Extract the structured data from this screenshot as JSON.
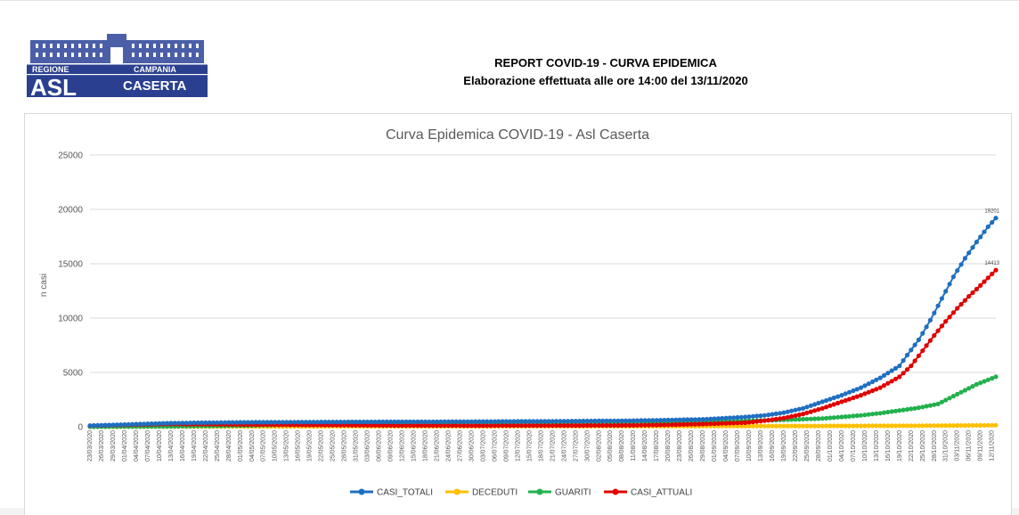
{
  "header": {
    "logo": {
      "icon": "palace-icon",
      "region_text": "REGIONE",
      "campania_text": "CAMPANIA",
      "asl_text": "ASL",
      "caserta_text": "CASERTA",
      "color": "#2a3f8f"
    },
    "title_line1": "REPORT COVID-19 - CURVA EPIDEMICA",
    "title_line2": "Elaborazione effettuata alle ore 14:00 del 13/11/2020"
  },
  "chart_data": {
    "type": "line",
    "title": "Curva Epidemica COVID-19 - Asl Caserta",
    "xlabel": "",
    "ylabel": "n casi",
    "ylim": [
      0,
      25000
    ],
    "yticks": [
      "0",
      "5000",
      "10000",
      "15000",
      "20000",
      "25000"
    ],
    "grid": true,
    "legend_position": "bottom",
    "x_start": "23/03/2020",
    "x_end": "13/11/2020",
    "x_tick_labels": [
      "23/03/2020",
      "26/03/2020",
      "29/03/2020",
      "01/04/2020",
      "04/04/2020",
      "07/04/2020",
      "10/04/2020",
      "13/04/2020",
      "16/04/2020",
      "19/04/2020",
      "22/04/2020",
      "25/04/2020",
      "28/04/2020",
      "01/05/2020",
      "04/05/2020",
      "07/05/2020",
      "10/05/2020",
      "13/05/2020",
      "16/05/2020",
      "19/05/2020",
      "22/05/2020",
      "25/05/2020",
      "28/05/2020",
      "31/05/2020",
      "03/06/2020",
      "06/06/2020",
      "09/06/2020",
      "12/06/2020",
      "15/06/2020",
      "18/06/2020",
      "21/06/2020",
      "24/06/2020",
      "27/06/2020",
      "30/06/2020",
      "03/07/2020",
      "06/07/2020",
      "09/07/2020",
      "12/07/2020",
      "15/07/2020",
      "18/07/2020",
      "21/07/2020",
      "24/07/2020",
      "27/07/2020",
      "30/07/2020",
      "02/08/2020",
      "05/08/2020",
      "08/08/2020",
      "11/08/2020",
      "14/08/2020",
      "17/08/2020",
      "20/08/2020",
      "23/08/2020",
      "26/08/2020",
      "29/08/2020",
      "01/09/2020",
      "04/09/2020",
      "07/09/2020",
      "10/09/2020",
      "13/09/2020",
      "16/09/2020",
      "19/09/2020",
      "22/09/2020",
      "25/09/2020",
      "28/09/2020",
      "01/10/2020",
      "04/10/2020",
      "07/10/2020",
      "10/10/2020",
      "13/10/2020",
      "16/10/2020",
      "19/10/2020",
      "22/10/2020",
      "25/10/2020",
      "28/10/2020",
      "31/10/2020",
      "03/11/2020",
      "06/11/2020",
      "09/11/2020",
      "12/11/2020"
    ],
    "series": [
      {
        "name": "CASI_TOTALI",
        "color": "#1f6fc1",
        "points": [
          [
            0,
            110
          ],
          [
            10,
            220
          ],
          [
            20,
            330
          ],
          [
            30,
            380
          ],
          [
            40,
            410
          ],
          [
            60,
            440
          ],
          [
            80,
            460
          ],
          [
            100,
            480
          ],
          [
            120,
            510
          ],
          [
            140,
            560
          ],
          [
            150,
            620
          ],
          [
            160,
            700
          ],
          [
            165,
            800
          ],
          [
            170,
            900
          ],
          [
            175,
            1050
          ],
          [
            180,
            1300
          ],
          [
            185,
            1700
          ],
          [
            190,
            2300
          ],
          [
            195,
            2900
          ],
          [
            200,
            3600
          ],
          [
            205,
            4500
          ],
          [
            210,
            5600
          ],
          [
            212,
            6600
          ],
          [
            215,
            8000
          ],
          [
            218,
            9800
          ],
          [
            221,
            11800
          ],
          [
            224,
            13800
          ],
          [
            227,
            15500
          ],
          [
            230,
            17000
          ],
          [
            233,
            18400
          ],
          [
            235,
            19201
          ]
        ],
        "last_label": "19201"
      },
      {
        "name": "DECEDUTI",
        "color": "#ffc000",
        "points": [
          [
            0,
            5
          ],
          [
            20,
            25
          ],
          [
            40,
            40
          ],
          [
            80,
            50
          ],
          [
            120,
            55
          ],
          [
            160,
            62
          ],
          [
            180,
            70
          ],
          [
            200,
            85
          ],
          [
            215,
            100
          ],
          [
            225,
            120
          ],
          [
            235,
            145
          ]
        ],
        "last_label": ""
      },
      {
        "name": "GUARITI",
        "color": "#22b14c",
        "points": [
          [
            0,
            5
          ],
          [
            20,
            30
          ],
          [
            40,
            110
          ],
          [
            60,
            260
          ],
          [
            80,
            340
          ],
          [
            100,
            370
          ],
          [
            120,
            390
          ],
          [
            140,
            420
          ],
          [
            160,
            470
          ],
          [
            170,
            530
          ],
          [
            180,
            640
          ],
          [
            190,
            760
          ],
          [
            200,
            1050
          ],
          [
            205,
            1250
          ],
          [
            210,
            1500
          ],
          [
            215,
            1750
          ],
          [
            220,
            2100
          ],
          [
            225,
            3000
          ],
          [
            230,
            3900
          ],
          [
            235,
            4600
          ]
        ],
        "last_label": ""
      },
      {
        "name": "CASI_ATTUALI",
        "color": "#e00000",
        "points": [
          [
            0,
            100
          ],
          [
            10,
            180
          ],
          [
            20,
            250
          ],
          [
            30,
            230
          ],
          [
            40,
            200
          ],
          [
            60,
            160
          ],
          [
            80,
            115
          ],
          [
            100,
            100
          ],
          [
            120,
            110
          ],
          [
            140,
            130
          ],
          [
            150,
            180
          ],
          [
            160,
            260
          ],
          [
            170,
            380
          ],
          [
            175,
            560
          ],
          [
            180,
            800
          ],
          [
            185,
            1180
          ],
          [
            190,
            1700
          ],
          [
            195,
            2300
          ],
          [
            200,
            2900
          ],
          [
            205,
            3600
          ],
          [
            210,
            4600
          ],
          [
            213,
            5600
          ],
          [
            216,
            7000
          ],
          [
            219,
            8400
          ],
          [
            222,
            9700
          ],
          [
            225,
            10900
          ],
          [
            228,
            12000
          ],
          [
            231,
            13000
          ],
          [
            235,
            14413
          ]
        ],
        "last_label": "14413"
      }
    ]
  }
}
